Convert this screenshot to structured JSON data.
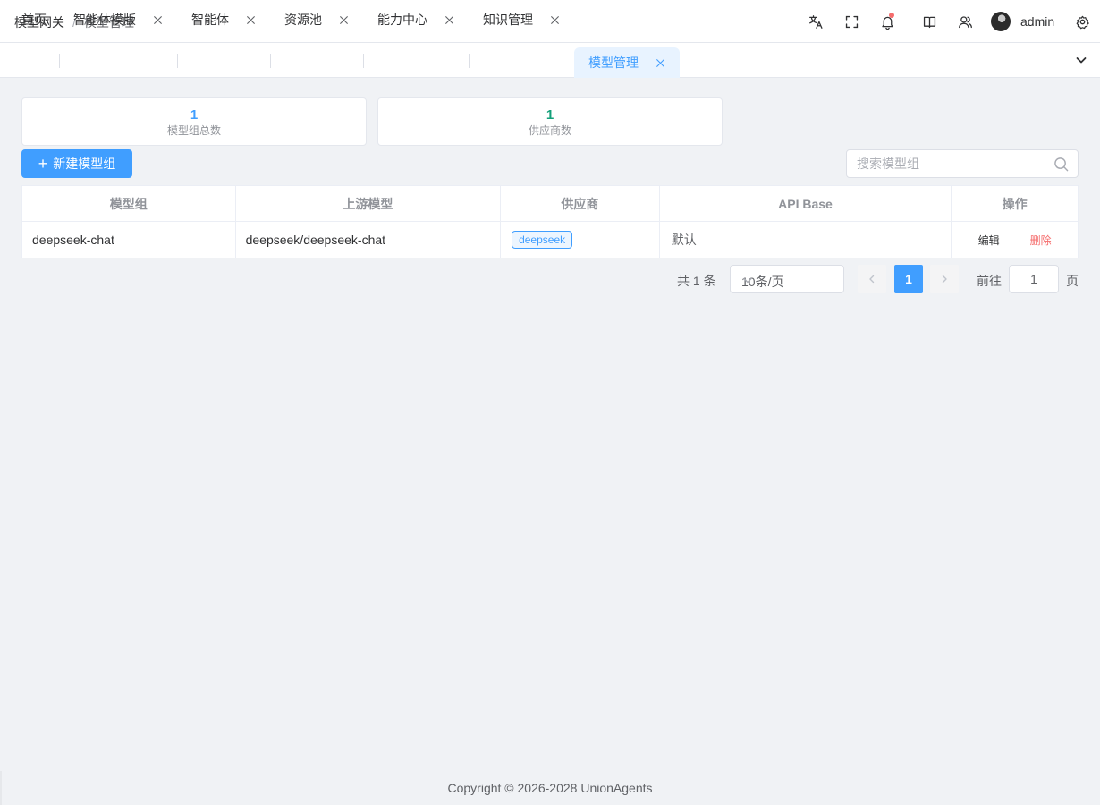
{
  "breadcrumb": {
    "parent": "模型网关",
    "separator": "/",
    "current": "模型管理"
  },
  "header": {
    "icons": [
      "translate-icon",
      "fullscreen-icon",
      "bell-icon",
      "book-icon",
      "user-icon",
      "gear-icon"
    ],
    "notification_dot_color": "#f56c6c",
    "username": "admin"
  },
  "tabs": [
    {
      "label": "首页",
      "closable": false,
      "active": false
    },
    {
      "label": "智能体模版",
      "closable": true,
      "active": false
    },
    {
      "label": "智能体",
      "closable": true,
      "active": false
    },
    {
      "label": "资源池",
      "closable": true,
      "active": false
    },
    {
      "label": "能力中心",
      "closable": true,
      "active": false
    },
    {
      "label": "知识管理",
      "closable": true,
      "active": false
    },
    {
      "label": "模型管理",
      "closable": true,
      "active": true
    }
  ],
  "stats": [
    {
      "value": "1",
      "label": "模型组总数",
      "color": "#409eff"
    },
    {
      "value": "1",
      "label": "供应商数",
      "color": "#13a07a"
    }
  ],
  "toolbar": {
    "new_button_label": "新建模型组",
    "search_placeholder": "搜索模型组",
    "search_value": ""
  },
  "table": {
    "columns": [
      "模型组",
      "上游模型",
      "供应商",
      "API Base",
      "操作"
    ],
    "rows": [
      {
        "model_group": "deepseek-chat",
        "upstream_model": "deepseek/deepseek-chat",
        "provider": "deepseek",
        "api_base": "默认",
        "edit_label": "编辑",
        "delete_label": "删除"
      }
    ]
  },
  "pagination": {
    "total_text": "共 1 条",
    "page_size": "10条/页",
    "current_page": "1",
    "goto_label": "前往",
    "goto_value": "1",
    "page_suffix": "页"
  },
  "colors": {
    "primary": "#409eff",
    "danger": "#f56c6c",
    "success": "#13a07a"
  },
  "footer": {
    "copyright": "Copyright © 2026-2028 UnionAgents"
  }
}
